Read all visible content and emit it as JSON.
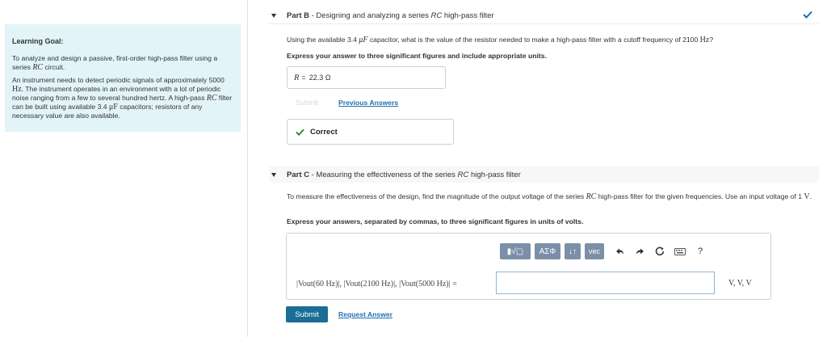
{
  "left_panel": {
    "goal_title": "Learning Goal:",
    "goal_text_1_a": "To analyze and design a passive, first-order high-pass filter using a series ",
    "goal_text_1_rc": "RC",
    "goal_text_1_b": " circuit.",
    "goal_text_2_a": "An instrument needs to detect periodic signals of approximately 5000 ",
    "goal_text_2_hz": "Hz",
    "goal_text_2_b": ". The instrument operates in an environment with a lot of periodic noise ranging from a few to several hundred hertz. A high-pass ",
    "goal_text_2_rc": "RC",
    "goal_text_2_c": " filter can be built using available 3.4 ",
    "goal_text_2_uf": "μF",
    "goal_text_2_d": " capacitors; resistors of any necessary value are also available."
  },
  "part_b": {
    "label": "Part B",
    "title_a": " - Designing and analyzing a series ",
    "title_rc": "RC",
    "title_b": " high-pass filter",
    "status": "correct",
    "question_a": "Using the available 3.4 ",
    "question_uf": "μF",
    "question_b": " capacitor, what is the value of the resistor needed to make a high-pass filter with a cutoff frequency of 2100 ",
    "question_hz": "Hz",
    "question_c": "?",
    "instruction": "Express your answer to three significant figures and include appropriate units.",
    "answer_var": "R",
    "answer_eq": "=",
    "answer_value": "22.3 Ω",
    "submit_label": "Submit",
    "previous_answers_label": "Previous Answers",
    "correct_label": "Correct"
  },
  "part_c": {
    "label": "Part C",
    "title_a": " - Measuring the effectiveness of the series ",
    "title_rc": "RC",
    "title_b": " high-pass filter",
    "question_a": "To measure the effectiveness of the design, find the magnitude of the output voltage of the series ",
    "question_rc": "RC",
    "question_b": " high-pass filter for the given frequencies. Use an input voltage of 1 ",
    "question_v": "V",
    "question_c": ".",
    "instruction": "Express your answers, separated by commas, to three significant figures in units of volts.",
    "expression": "|Vout(60 Hz)|, |Vout(2100 Hz)|, |Vout(5000 Hz)| = ",
    "answer_value": "",
    "units": "V, V, V",
    "toolbar": {
      "templates_label": "▮√▢",
      "greek_label": "ΑΣΦ",
      "arrows_label": "↓↑",
      "vec_label": "vec",
      "help_label": "?"
    },
    "submit_label": "Submit",
    "request_answer_label": "Request Answer"
  },
  "colors": {
    "panel_bg": "#e3f4f8",
    "link": "#1f6fb2",
    "submit": "#1a6d96",
    "correct": "#2e8b3a",
    "toolbar_btn": "#7b8fa8"
  }
}
